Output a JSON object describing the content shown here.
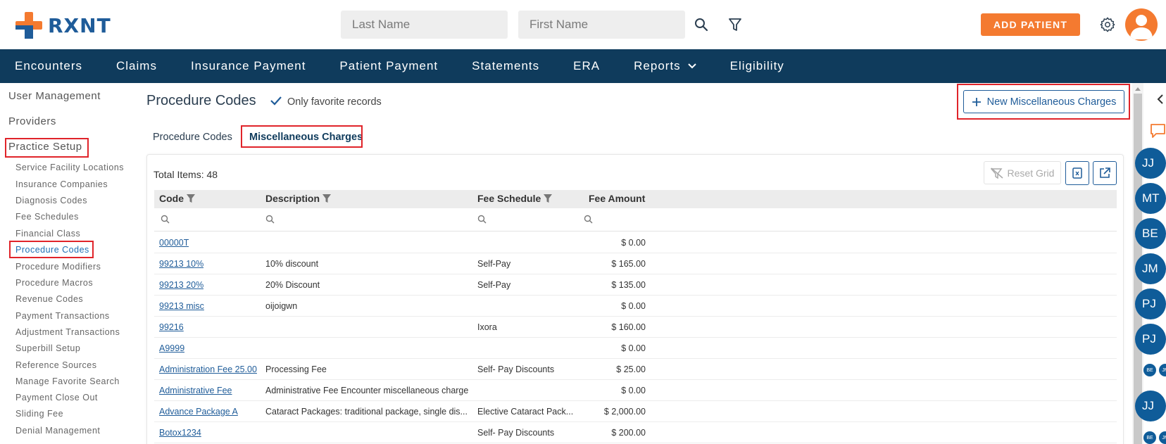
{
  "app": {
    "logo_text": "RXNT"
  },
  "header": {
    "last_name_placeholder": "Last Name",
    "first_name_placeholder": "First Name",
    "add_patient_label": "ADD PATIENT"
  },
  "nav": {
    "items": [
      "Encounters",
      "Claims",
      "Insurance Payment",
      "Patient Payment",
      "Statements",
      "ERA",
      "Reports",
      "Eligibility"
    ]
  },
  "sidebar": {
    "top_items": [
      "User Management",
      "Providers",
      "Practice Setup"
    ],
    "sub_items": [
      "Service Facility Locations",
      "Insurance Companies",
      "Diagnosis Codes",
      "Fee Schedules",
      "Financial Class",
      "Procedure Codes",
      "Procedure Modifiers",
      "Procedure Macros",
      "Revenue Codes",
      "Payment Transactions",
      "Adjustment Transactions",
      "Superbill Setup",
      "Reference Sources",
      "Manage Favorite Search",
      "Payment Close Out",
      "Sliding Fee",
      "Denial Management"
    ],
    "active_sub_item": "Procedure Codes"
  },
  "page": {
    "title": "Procedure Codes",
    "only_favorite_label": "Only favorite records",
    "new_misc_label": "New Miscellaneous Charges",
    "tabs": [
      "Procedure Codes",
      "Miscellaneous Charges"
    ],
    "active_tab": "Miscellaneous Charges"
  },
  "grid": {
    "total_items_label": "Total Items: 48",
    "reset_grid_label": "Reset Grid",
    "columns": [
      "Code",
      "Description",
      "Fee Schedule",
      "Fee Amount"
    ],
    "rows": [
      {
        "code": "00000T",
        "description": "",
        "fee_schedule": "",
        "fee_amount": "$ 0.00"
      },
      {
        "code": "99213 10%",
        "description": "10% discount",
        "fee_schedule": "Self-Pay",
        "fee_amount": "$ 165.00"
      },
      {
        "code": "99213 20%",
        "description": "20% Discount",
        "fee_schedule": "Self-Pay",
        "fee_amount": "$ 135.00"
      },
      {
        "code": "99213 misc",
        "description": "oijoigwn",
        "fee_schedule": "",
        "fee_amount": "$ 0.00"
      },
      {
        "code": "99216",
        "description": "",
        "fee_schedule": "Ixora",
        "fee_amount": "$ 160.00"
      },
      {
        "code": "A9999",
        "description": "",
        "fee_schedule": "",
        "fee_amount": "$ 0.00"
      },
      {
        "code": "Administration Fee 25.00",
        "description": "Processing Fee",
        "fee_schedule": "Self- Pay Discounts",
        "fee_amount": "$ 25.00"
      },
      {
        "code": "Administrative Fee",
        "description": "Administrative Fee Encounter miscellaneous charge",
        "fee_schedule": "",
        "fee_amount": "$ 0.00"
      },
      {
        "code": "Advance Package A",
        "description": "Cataract Packages: traditional package, single dis...",
        "fee_schedule": "Elective Cataract Pack...",
        "fee_amount": "$ 2,000.00"
      },
      {
        "code": "Botox1234",
        "description": "",
        "fee_schedule": "Self- Pay Discounts",
        "fee_amount": "$ 200.00"
      }
    ]
  },
  "chat_rail": {
    "bubbles": [
      "JJ",
      "MT",
      "BE",
      "JM",
      "PJ",
      "PJ"
    ],
    "mini_bubbles_row1": [
      "BE",
      "JM"
    ],
    "bubble_after_mini": "JJ",
    "mini_bubbles_row2": [
      "BE",
      "JM"
    ]
  },
  "colors": {
    "brand_orange": "#f47a30",
    "brand_blue": "#1f5c99",
    "nav_background": "#0f3b5c",
    "highlight_red": "#e0242a"
  }
}
